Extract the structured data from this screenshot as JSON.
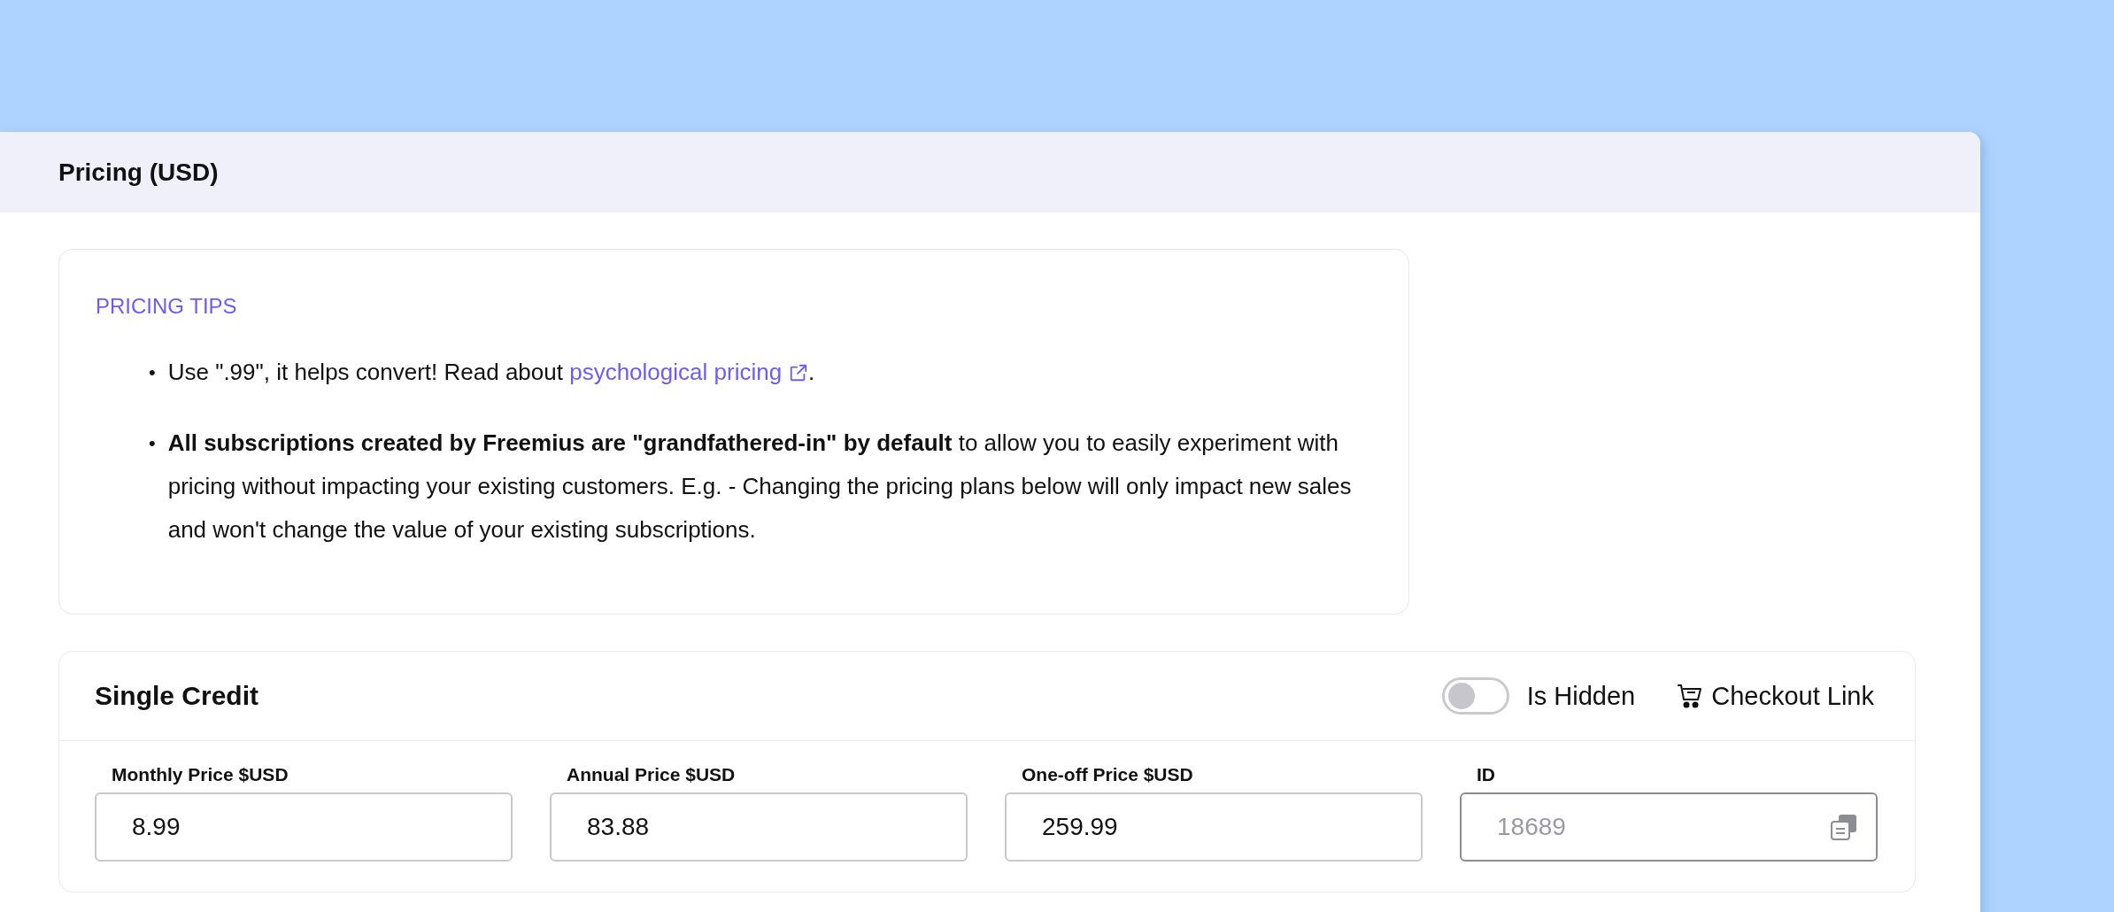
{
  "panel": {
    "title": "Pricing (USD)"
  },
  "tips": {
    "heading": "PRICING TIPS",
    "items": [
      {
        "kind": "link",
        "marker": "•",
        "before": "Use \".99\", it helps convert! Read about ",
        "link": "psychological pricing",
        "after": "."
      },
      {
        "kind": "text",
        "marker": "•",
        "text": "**All subscriptions created by Freemius are \"grandfathered-in\" by default** to allow you to easily experiment with pricing without impacting your existing customers. E.g. - Changing the pricing plans below will only impact new sales and won't change the value of your existing subscriptions."
      }
    ]
  },
  "plan": {
    "name": "Single Credit",
    "hidden_toggle": {
      "label": "Is Hidden",
      "on": false
    },
    "checkout_link": "Checkout Link",
    "fields": [
      {
        "kind": "price",
        "label": "Monthly Price $USD",
        "value": "8.99",
        "disabled": false
      },
      {
        "kind": "price",
        "label": "Annual Price $USD",
        "value": "83.88",
        "disabled": false
      },
      {
        "kind": "price",
        "label": "One-off Price $USD",
        "value": "259.99",
        "disabled": false
      },
      {
        "kind": "id",
        "label": "ID",
        "value": "18689",
        "disabled": true
      }
    ]
  }
}
